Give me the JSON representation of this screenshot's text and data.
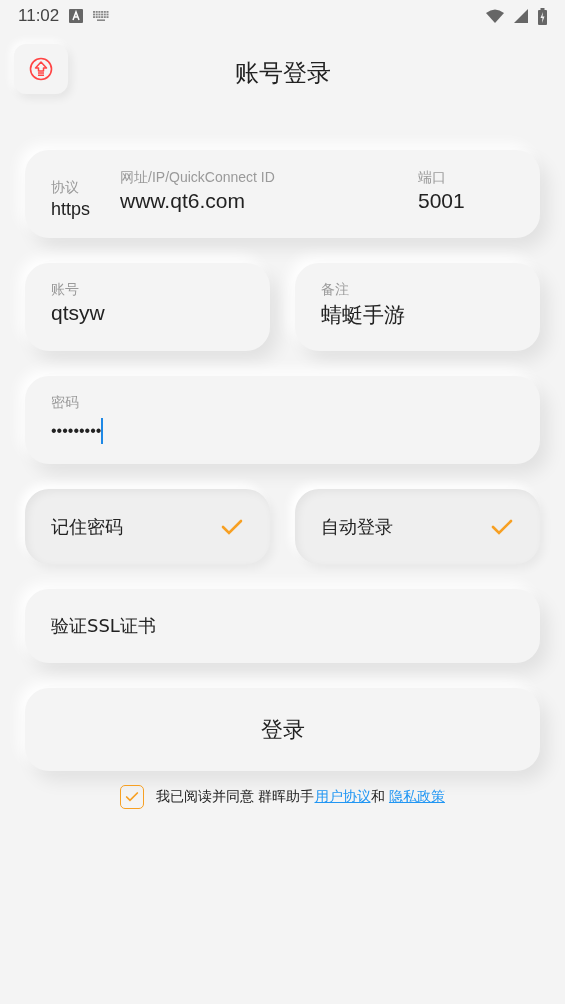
{
  "status_bar": {
    "time": "11:02"
  },
  "header": {
    "title": "账号登录"
  },
  "server": {
    "protocol": {
      "label": "协议",
      "value": "https"
    },
    "address": {
      "label": "网址/IP/QuickConnect ID",
      "value": "www.qt6.com"
    },
    "port": {
      "label": "端口",
      "value": "5001"
    }
  },
  "account": {
    "label": "账号",
    "value": "qtsyw"
  },
  "note": {
    "label": "备注",
    "value": "蜻蜓手游"
  },
  "password": {
    "label": "密码",
    "value": "•••••••••",
    "focused": true
  },
  "toggles": [
    {
      "label": "记住密码",
      "checked": true
    },
    {
      "label": "自动登录",
      "checked": true
    }
  ],
  "ssl": {
    "label": "验证SSL证书",
    "checked": false
  },
  "login_button": "登录",
  "agreement": {
    "checked": true,
    "text": "我已阅读并同意 群晖助手",
    "link1": "用户协议",
    "and": "和",
    "link2": "隐私政策"
  }
}
